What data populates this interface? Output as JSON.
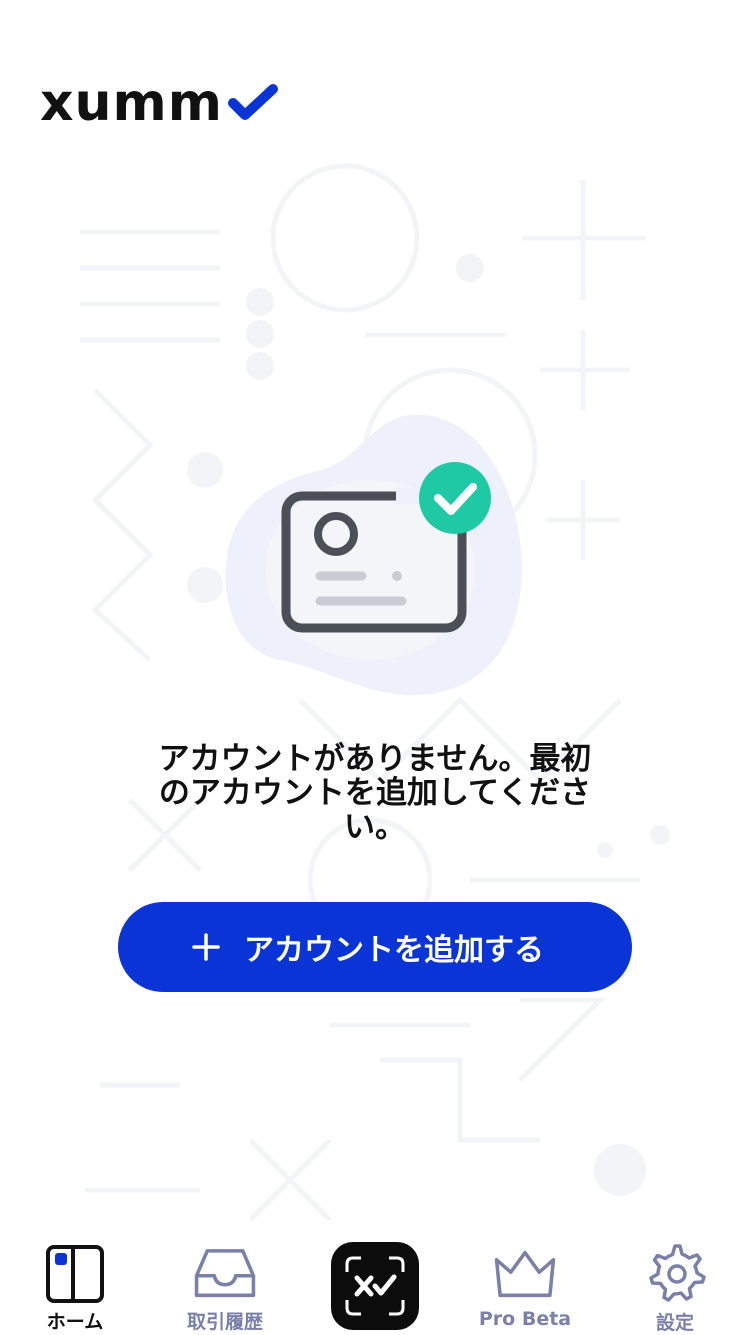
{
  "app": {
    "logo_text": "xumm",
    "brand_color": "#0a34d5",
    "check_color": "#20c9a6"
  },
  "empty_state": {
    "message": "アカウントがありません。最初のアカウントを追加してください。",
    "illustration_icon": "card-with-check-icon"
  },
  "actions": {
    "add_account_label": "アカウントを追加する",
    "add_icon": "plus-icon"
  },
  "tabbar": {
    "tabs": [
      {
        "label": "ホーム",
        "icon": "home-icon",
        "active": true
      },
      {
        "label": "取引履歴",
        "icon": "inbox-icon",
        "active": false
      },
      {
        "label": "",
        "icon": "scan-icon",
        "active": false
      },
      {
        "label": "Pro Beta",
        "icon": "crown-icon",
        "active": false
      },
      {
        "label": "設定",
        "icon": "gear-icon",
        "active": false
      }
    ]
  }
}
